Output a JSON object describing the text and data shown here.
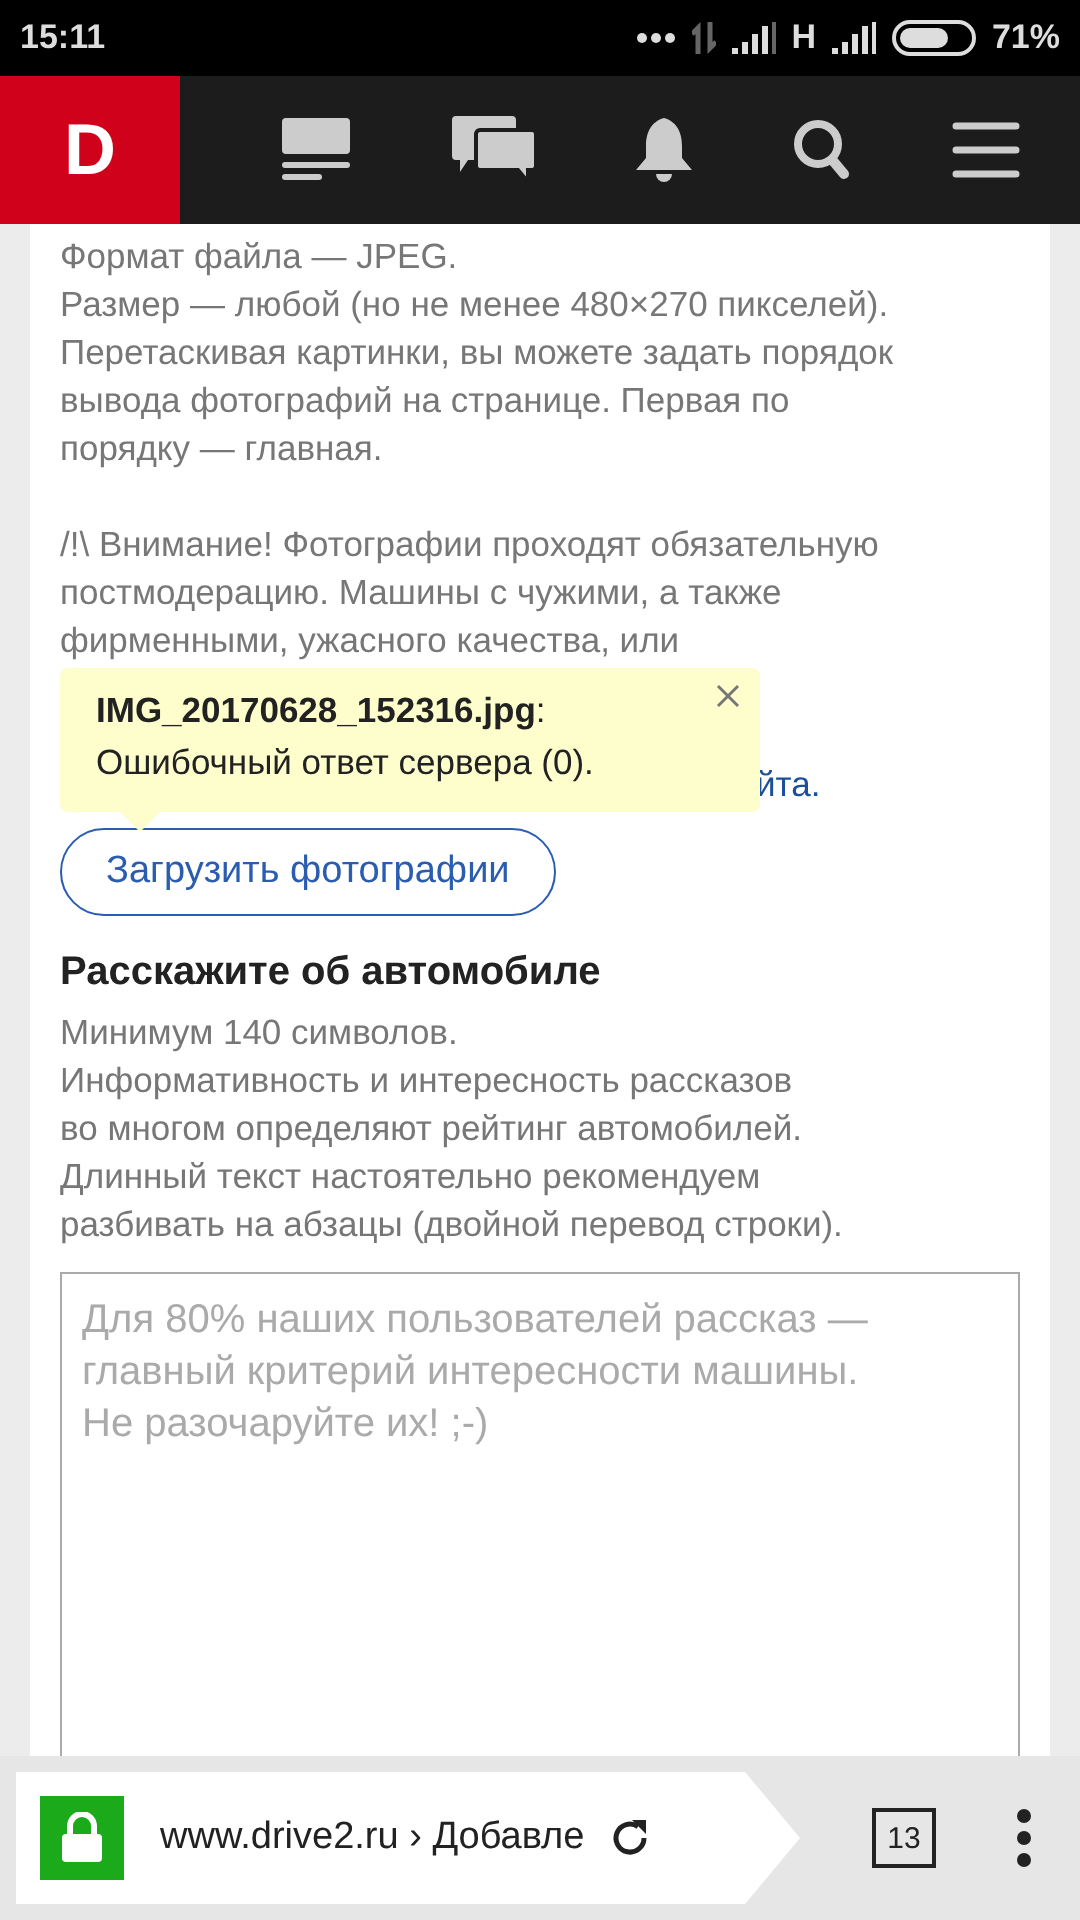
{
  "status_bar": {
    "time": "15:11",
    "network": "H",
    "battery": "71%"
  },
  "site_nav": {
    "logo": "D"
  },
  "photo_rules": {
    "text": "Формат файла — JPEG.\nРазмер — любой (но не менее 480×270 пикселей).\nПеретаскивая картинки, вы можете задать порядок\nвывода фотографий на странице. Первая по\nпорядку — главная.",
    "warning": "/!\\ Внимание! Фотографии проходят обязательную\nпостмодерацию. Машины с чужими, а также\nфирменными, ужасного качества, или",
    "link_fragment": "йта."
  },
  "error_tooltip": {
    "message": "**IMG_20170628_152316.jpg**:\nОшибочный ответ сервера (0)."
  },
  "upload_button": "Загрузить фотографии",
  "story": {
    "heading": "Расскажите об автомобиле",
    "hint": "Минимум 140 символов.\nИнформативность и интересность рассказов\nво многом определяют рейтинг автомобилей.\nДлинный текст настоятельно рекомендуем\nразбивать на абзацы (двойной перевод строки).",
    "placeholder": "Для 80% наших пользователей рассказ —\nглавный критерий интересности машины.\nНе разочаруйте их! ;-)"
  },
  "browser_bar": {
    "url": "www.drive2.ru › Добавле",
    "secure": true,
    "tab_count": "13"
  }
}
